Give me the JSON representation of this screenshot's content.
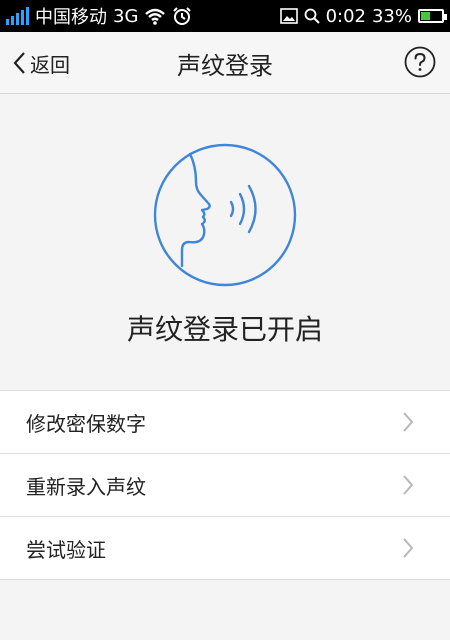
{
  "status_bar": {
    "carrier": "中国移动",
    "network": "3G",
    "time": "0:02",
    "battery": "33%",
    "battery_level": 0.33,
    "icons": [
      "signal-icon",
      "wifi-icon",
      "alarm-icon",
      "image-icon",
      "search-icon",
      "battery-icon"
    ]
  },
  "nav": {
    "back_label": "返回",
    "title": "声纹登录",
    "help_icon": "question-icon"
  },
  "hero": {
    "icon": "voice-face-icon",
    "status_text": "声纹登录已开启"
  },
  "menu": {
    "items": [
      {
        "label": "修改密保数字"
      },
      {
        "label": "重新录入声纹"
      },
      {
        "label": "尝试验证"
      }
    ]
  },
  "colors": {
    "accent": "#3f86d8",
    "status_bg": "#000000",
    "signal": "#2aa3ff",
    "battery_fill": "#45c93a"
  }
}
